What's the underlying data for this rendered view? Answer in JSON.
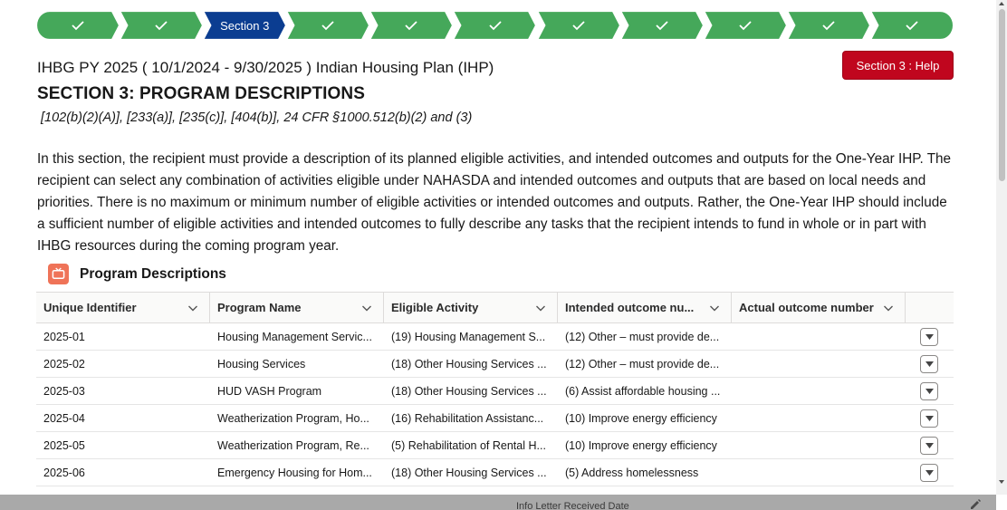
{
  "stepper": {
    "colors": {
      "complete": "#45a85a",
      "current": "#0b3d91"
    },
    "steps": [
      {
        "state": "complete",
        "label": "",
        "icon": "check-icon"
      },
      {
        "state": "complete",
        "label": "",
        "icon": "check-icon"
      },
      {
        "state": "current",
        "label": "Section 3",
        "icon": ""
      },
      {
        "state": "complete",
        "label": "",
        "icon": "check-icon"
      },
      {
        "state": "complete",
        "label": "",
        "icon": "check-icon"
      },
      {
        "state": "complete",
        "label": "",
        "icon": "check-icon"
      },
      {
        "state": "complete",
        "label": "",
        "icon": "check-icon"
      },
      {
        "state": "complete",
        "label": "",
        "icon": "check-icon"
      },
      {
        "state": "complete",
        "label": "",
        "icon": "check-icon"
      },
      {
        "state": "complete",
        "label": "",
        "icon": "check-icon"
      },
      {
        "state": "complete",
        "label": "",
        "icon": "check-icon"
      }
    ]
  },
  "header": {
    "title": "IHBG PY 2025 ( 10/1/2024 - 9/30/2025 ) Indian Housing Plan (IHP)",
    "help_button": "Section 3 : Help"
  },
  "section": {
    "heading": "SECTION 3: PROGRAM DESCRIPTIONS",
    "citation": "[102(b)(2)(A)], [233(a)], [235(c)], [404(b)], 24 CFR §1000.512(b)(2) and (3)",
    "intro": "In this section, the recipient must provide a description of its planned eligible activities, and intended outcomes and outputs for the One-Year IHP. The recipient can select any combination of activities eligible under NAHASDA and intended outcomes and outputs that are based on local needs and priorities. There is no maximum or minimum number of eligible activities or intended outcomes and outputs. Rather, the One-Year IHP should include a sufficient number of eligible activities and intended outcomes to fully describe any tasks that the recipient intends to fund in whole or in part with IHBG resources during the coming program year."
  },
  "card": {
    "title": "Program Descriptions",
    "icon": "tv-icon"
  },
  "table": {
    "columns": [
      "Unique Identifier",
      "Program Name",
      "Eligible Activity",
      "Intended outcome nu...",
      "Actual outcome number"
    ],
    "rows": [
      [
        "2025-01",
        "Housing Management Servic...",
        "(19) Housing Management S...",
        "(12) Other – must provide de...",
        ""
      ],
      [
        "2025-02",
        "Housing Services",
        "(18) Other Housing Services ...",
        "(12) Other – must provide de...",
        ""
      ],
      [
        "2025-03",
        "HUD VASH Program",
        "(18) Other Housing Services ...",
        "(6) Assist affordable housing ...",
        ""
      ],
      [
        "2025-04",
        "Weatherization Program, Ho...",
        "(16) Rehabilitation Assistanc...",
        "(10) Improve energy efficiency",
        ""
      ],
      [
        "2025-05",
        "Weatherization Program, Re...",
        "(5) Rehabilitation of Rental H...",
        "(10) Improve energy efficiency",
        ""
      ],
      [
        "2025-06",
        "Emergency Housing for Hom...",
        "(18) Other Housing Services ...",
        "(5) Address homelessness",
        ""
      ]
    ]
  },
  "footer": {
    "label": "Info Letter Received Date"
  }
}
